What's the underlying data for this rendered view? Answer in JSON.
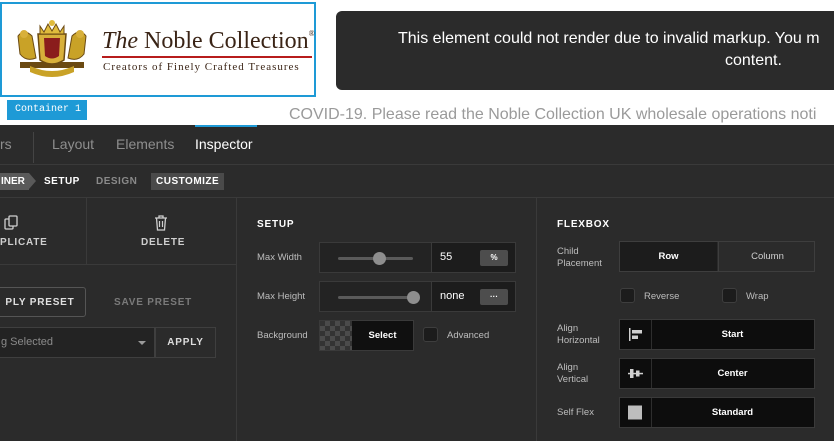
{
  "preview": {
    "logo": {
      "title_italic": "The",
      "title_main": "Noble Collection",
      "trademark": "®",
      "tagline": "Creators of Finely Crafted Treasures"
    },
    "container_tag": "Container 1",
    "error_line1": "This element could not render due to invalid markup. You m",
    "error_line2": "content.",
    "notice": "COVID-19. Please read the Noble Collection UK wholesale operations noti"
  },
  "editor": {
    "tabs": [
      {
        "label": "rs"
      },
      {
        "label": "Layout"
      },
      {
        "label": "Elements"
      },
      {
        "label": "Inspector"
      }
    ],
    "breadcrumb": {
      "container": "INER",
      "setup": "SETUP",
      "design": "DESIGN",
      "customize": "CUSTOMIZE"
    },
    "actions": {
      "duplicate": "PLICATE",
      "delete": "DELETE"
    },
    "presets": {
      "apply": "PLY PRESET",
      "save": "SAVE PRESET",
      "selected": "g Selected",
      "apply_button": "APPLY"
    },
    "setup": {
      "title": "SETUP",
      "max_width": {
        "label": "Max Width",
        "value": "55",
        "unit": "%",
        "slider_level": 0.55
      },
      "max_height": {
        "label": "Max Height",
        "value": "none",
        "unit": "···",
        "slider_level": 1.0
      },
      "background": {
        "label": "Background",
        "select": "Select",
        "advanced": "Advanced"
      }
    },
    "flexbox": {
      "title": "FLEXBOX",
      "child_placement": {
        "label_line1": "Child",
        "label_line2": "Placement",
        "options": [
          "Row",
          "Column"
        ],
        "selected": "Row"
      },
      "reverse": "Reverse",
      "wrap": "Wrap",
      "align_horizontal": {
        "label_line1": "Align",
        "label_line2": "Horizontal",
        "value": "Start"
      },
      "align_vertical": {
        "label_line1": "Align",
        "label_line2": "Vertical",
        "value": "Center"
      },
      "self_flex": {
        "label": "Self Flex",
        "value": "Standard"
      }
    }
  }
}
